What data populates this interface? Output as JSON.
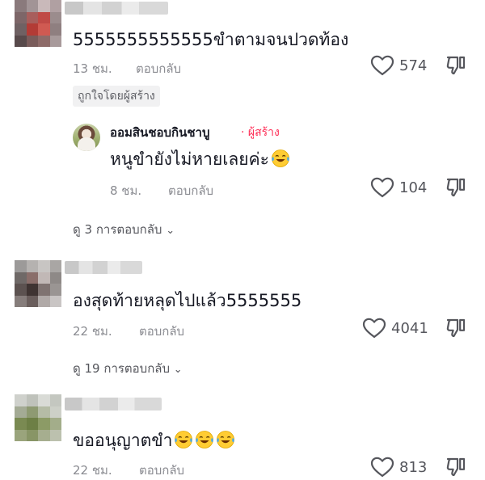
{
  "comments": [
    {
      "text": "5555555555555ขำตามจนปวดท้อง",
      "time": "13 ชม.",
      "reply_label": "ตอบกลับ",
      "likes": "574",
      "badge": "ถูกใจโดยผู้สร้าง",
      "reply": {
        "author": "ออมสินชอบกินชาบู",
        "creator_tag": "· ผู้สร้าง",
        "text": "หนูขำยังไม่หายเลยค่ะ",
        "time": "8 ชม.",
        "reply_label": "ตอบกลับ",
        "likes": "104",
        "emoji": "face-with-tears-of-joy"
      },
      "view_replies": "ดู 3 การตอบกลับ"
    },
    {
      "text": "องสุดท้ายหลุดไปแล้ว5555555",
      "time": "22 ชม.",
      "reply_label": "ตอบกลับ",
      "likes": "4041",
      "view_replies": "ดู 19 การตอบกลับ"
    },
    {
      "text": "ขออนุญาตขำ",
      "time": "22 ชม.",
      "reply_label": "ตอบกลับ",
      "likes": "813",
      "emoji": "face-with-tears-of-joy"
    }
  ],
  "colors": {
    "creator": "#fe2c55",
    "muted": "#8a8b91",
    "text": "#161823"
  }
}
